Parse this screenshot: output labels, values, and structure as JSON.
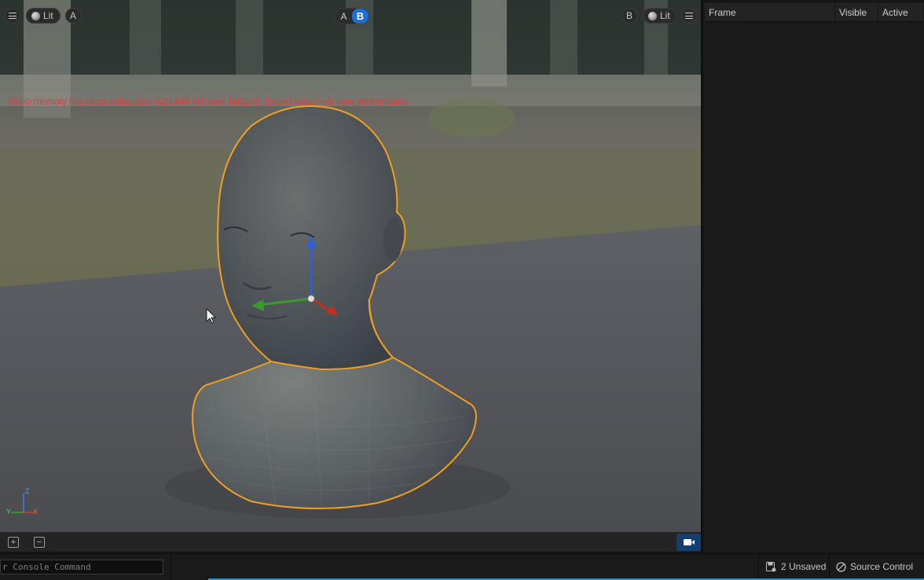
{
  "viewport": {
    "left_toolbar": {
      "menu_icon": "hamburger-icon",
      "view_mode": "Lit",
      "slot_label": "A"
    },
    "ab_toggle": {
      "a": "A",
      "b": "B",
      "selected": "B"
    },
    "right_toolbar": {
      "slot_label": "B",
      "view_mode": "Lit",
      "menu_icon": "hamburger-icon"
    },
    "warning": "Video memory has been exhausted (429.445 MB over budget). Expect extremely poor performance.",
    "axis": {
      "z": "Z",
      "y": "Y",
      "x": "X"
    }
  },
  "viewport_bottom": {
    "add_icon": "plus-icon",
    "remove_icon": "minus-icon",
    "camera_icon": "camera-icon"
  },
  "outliner": {
    "columns": [
      "Frame",
      "Visible",
      "Active"
    ]
  },
  "status": {
    "console_placeholder": "r Console Command",
    "unsaved": "2 Unsaved",
    "source_control": "Source Control"
  },
  "colors": {
    "accent": "#1a6fd4",
    "warning": "#e23a3a",
    "selection_outline": "#f0a020"
  }
}
